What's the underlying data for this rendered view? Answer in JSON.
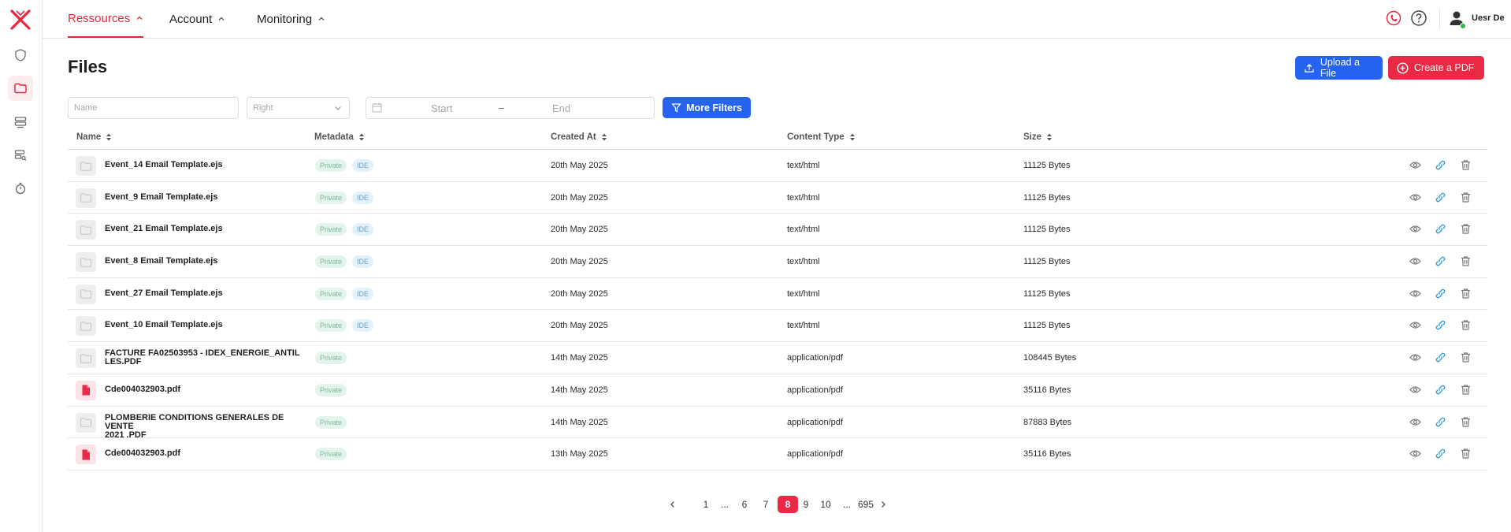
{
  "colors": {
    "brand": "#e8263f",
    "primary": "#2563f0",
    "danger": "#ea2a45",
    "online": "#2fb84a"
  },
  "sidebar": {
    "logo_icon": "x-logo-icon",
    "items": [
      {
        "icon": "shield-icon"
      },
      {
        "icon": "folder-icon",
        "active": true
      },
      {
        "icon": "database-list-icon"
      },
      {
        "icon": "database-search-icon"
      },
      {
        "icon": "stopwatch-icon"
      }
    ]
  },
  "topnav": {
    "tabs": [
      {
        "label": "Ressources",
        "active": true
      },
      {
        "label": "Account"
      },
      {
        "label": "Monitoring"
      }
    ],
    "user_name": "Uesr De"
  },
  "page": {
    "title": "Files",
    "upload_label": "Upload a File",
    "create_pdf_label": "Create a PDF"
  },
  "filters": {
    "name_placeholder": "Name",
    "select_value": "Right",
    "date_start": "Start",
    "date_separator": "–",
    "date_end": "End",
    "more_filters_label": "More Filters"
  },
  "table": {
    "columns": [
      "Name",
      "Metadata",
      "Created At",
      "Content Type",
      "Size"
    ],
    "rows": [
      {
        "name": "Event_14 Email Template.ejs",
        "type": "file",
        "tags": [
          "Private",
          "IDE"
        ],
        "created": "20th May 2025",
        "content_type": "text/html",
        "size": "11125 Bytes"
      },
      {
        "name": "Event_9 Email Template.ejs",
        "type": "file",
        "tags": [
          "Private",
          "IDE"
        ],
        "created": "20th May 2025",
        "content_type": "text/html",
        "size": "11125 Bytes"
      },
      {
        "name": "Event_21 Email Template.ejs",
        "type": "file",
        "tags": [
          "Private",
          "IDE"
        ],
        "created": "20th May 2025",
        "content_type": "text/html",
        "size": "11125 Bytes"
      },
      {
        "name": "Event_8 Email Template.ejs",
        "type": "file",
        "tags": [
          "Private",
          "IDE"
        ],
        "created": "20th May 2025",
        "content_type": "text/html",
        "size": "11125 Bytes"
      },
      {
        "name": "Event_27 Email Template.ejs",
        "type": "file",
        "tags": [
          "Private",
          "IDE"
        ],
        "created": "20th May 2025",
        "content_type": "text/html",
        "size": "11125 Bytes"
      },
      {
        "name": "Event_10 Email Template.ejs",
        "type": "file",
        "tags": [
          "Private",
          "IDE"
        ],
        "created": "20th May 2025",
        "content_type": "text/html",
        "size": "11125 Bytes"
      },
      {
        "name_line1": "FACTURE FA02503953 - IDEX_ENERGIE_ANTIL",
        "name_line2": "LES.PDF",
        "type": "file",
        "tags": [
          "Private"
        ],
        "created": "14th May 2025",
        "content_type": "application/pdf",
        "size": "108445 Bytes"
      },
      {
        "name": "Cde004032903.pdf",
        "type": "pdf",
        "tags": [
          "Private"
        ],
        "created": "14th May 2025",
        "content_type": "application/pdf",
        "size": "35116 Bytes"
      },
      {
        "name_line1": "PLOMBERIE CONDITIONS GENERALES DE VENTE",
        "name_line2": "2021 .PDF",
        "type": "file",
        "tags": [
          "Private"
        ],
        "created": "14th May 2025",
        "content_type": "application/pdf",
        "size": "87883 Bytes"
      },
      {
        "name": "Cde004032903.pdf",
        "type": "pdf",
        "tags": [
          "Private"
        ],
        "created": "13th May 2025",
        "content_type": "application/pdf",
        "size": "35116 Bytes"
      }
    ],
    "row_action_icons": [
      "eye-icon",
      "link-icon",
      "trash-icon"
    ]
  },
  "pagination": {
    "items": [
      "1",
      "...",
      "6",
      "7",
      "8",
      "9",
      "10",
      "...",
      "695"
    ],
    "current": "8"
  }
}
